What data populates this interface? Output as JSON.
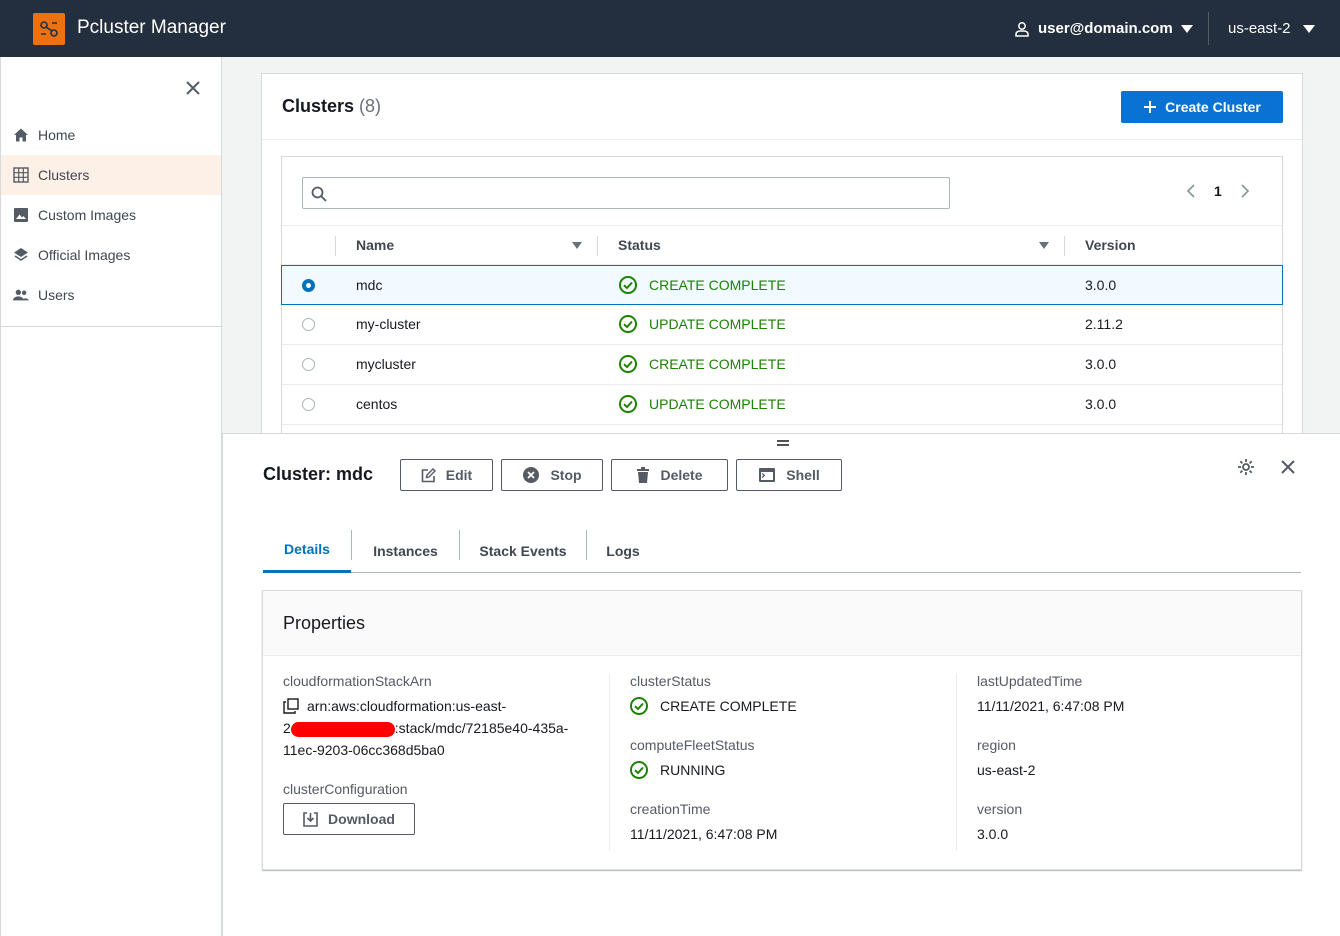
{
  "header": {
    "app_title": "Pcluster Manager",
    "user_email": "user@domain.com",
    "region": "us-east-2"
  },
  "sidebar": {
    "items": [
      {
        "label": "Home",
        "icon": "home-icon"
      },
      {
        "label": "Clusters",
        "icon": "grid-icon",
        "active": true
      },
      {
        "label": "Custom Images",
        "icon": "image-icon"
      },
      {
        "label": "Official Images",
        "icon": "layers-icon"
      },
      {
        "label": "Users",
        "icon": "users-icon"
      }
    ]
  },
  "clusters": {
    "title": "Clusters",
    "count": "(8)",
    "create_label": "Create Cluster",
    "search_placeholder": "",
    "page": "1",
    "columns": {
      "name": "Name",
      "status": "Status",
      "version": "Version"
    },
    "rows": [
      {
        "name": "mdc",
        "status": "CREATE COMPLETE",
        "version": "3.0.0",
        "selected": true
      },
      {
        "name": "my-cluster",
        "status": "UPDATE COMPLETE",
        "version": "2.11.2"
      },
      {
        "name": "mycluster",
        "status": "CREATE COMPLETE",
        "version": "3.0.0"
      },
      {
        "name": "centos",
        "status": "UPDATE COMPLETE",
        "version": "3.0.0"
      }
    ]
  },
  "split_panel": {
    "title": "Cluster: mdc",
    "actions": {
      "edit": "Edit",
      "stop": "Stop",
      "delete": "Delete",
      "shell": "Shell"
    },
    "tabs": [
      "Details",
      "Instances",
      "Stack Events",
      "Logs"
    ],
    "properties": {
      "heading": "Properties",
      "stack_arn_label": "cloudformationStackArn",
      "stack_arn_part1": "arn:aws:cloudformation:us-east-",
      "stack_arn_part2": "2",
      "stack_arn_part3": ":stack/mdc/72185e40-435a-",
      "stack_arn_part4": "11ec-9203-06cc368d5ba0",
      "cluster_config_label": "clusterConfiguration",
      "download_label": "Download",
      "cluster_status_label": "clusterStatus",
      "cluster_status": "CREATE COMPLETE",
      "compute_fleet_label": "computeFleetStatus",
      "compute_fleet_status": "RUNNING",
      "creation_time_label": "creationTime",
      "creation_time": "11/11/2021, 6:47:08 PM",
      "last_updated_label": "lastUpdatedTime",
      "last_updated": "11/11/2021, 6:47:08 PM",
      "region_label": "region",
      "region": "us-east-2",
      "version_label": "version",
      "version": "3.0.0"
    }
  },
  "colors": {
    "accent": "#0972d3",
    "success": "#1d8102",
    "header_bg": "#232f3e",
    "brand": "#ec7211"
  }
}
